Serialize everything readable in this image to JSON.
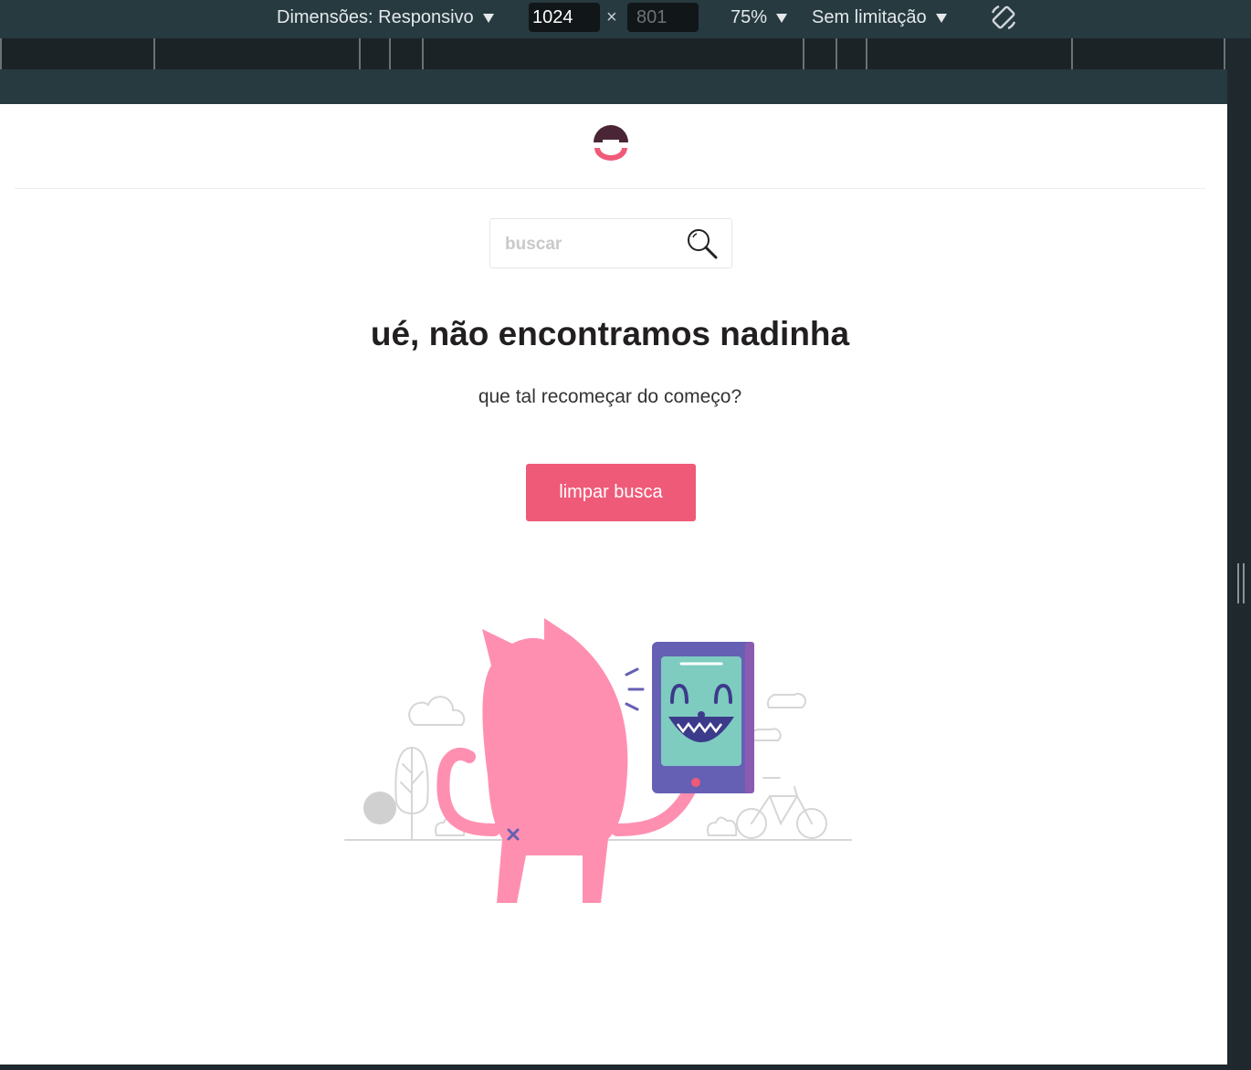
{
  "devtools": {
    "dimensions_label": "Dimensões: Responsivo",
    "width_value": "1024",
    "times": "×",
    "height_placeholder": "801",
    "zoom": "75%",
    "throttle": "Sem limitação",
    "rotate_icon": "rotate-icon"
  },
  "page": {
    "search": {
      "placeholder": "buscar",
      "icon": "search-icon"
    },
    "title": "ué, não encontramos nadinha",
    "subtitle": "que tal recomeçar do começo?",
    "button_label": "limpar busca"
  },
  "colors": {
    "accent": "#ef5a78",
    "logo_dark": "#4a2536",
    "cat_pink": "#ff8fb0",
    "tablet_purple": "#6560b4",
    "screen_teal": "#7ecbc0"
  }
}
